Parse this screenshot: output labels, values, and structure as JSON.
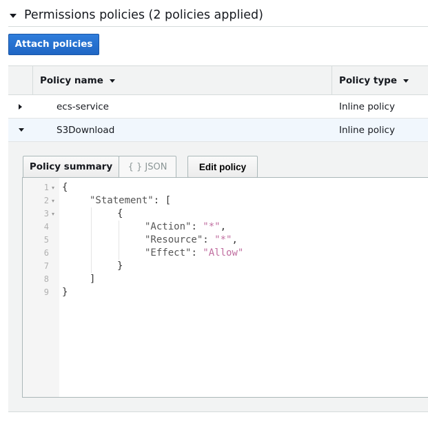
{
  "section": {
    "title": "Permissions policies (2 policies applied)"
  },
  "toolbar": {
    "attach_label": "Attach policies"
  },
  "table": {
    "columns": [
      {
        "label": "Policy name"
      },
      {
        "label": "Policy type"
      }
    ],
    "rows": [
      {
        "name": "ecs-service",
        "type": "Inline policy",
        "expanded": false
      },
      {
        "name": "S3Download",
        "type": "Inline policy",
        "expanded": true
      }
    ]
  },
  "detail": {
    "tabs": [
      {
        "label": "Policy summary"
      },
      {
        "label": "{ } JSON"
      }
    ],
    "edit_label": "Edit policy"
  },
  "editor": {
    "line_numbers": [
      "1",
      "2",
      "3",
      "4",
      "5",
      "6",
      "7",
      "8",
      "9"
    ],
    "lines": [
      {
        "indent": 0,
        "tokens": [
          {
            "t": "punc",
            "v": "{"
          }
        ]
      },
      {
        "indent": 1,
        "tokens": [
          {
            "t": "key",
            "v": "\"Statement\""
          },
          {
            "t": "punc",
            "v": ": ["
          }
        ]
      },
      {
        "indent": 2,
        "tokens": [
          {
            "t": "punc",
            "v": "{"
          }
        ]
      },
      {
        "indent": 3,
        "tokens": [
          {
            "t": "key",
            "v": "\"Action\""
          },
          {
            "t": "punc",
            "v": ": "
          },
          {
            "t": "str",
            "v": "\"*\""
          },
          {
            "t": "punc",
            "v": ","
          }
        ]
      },
      {
        "indent": 3,
        "tokens": [
          {
            "t": "key",
            "v": "\"Resource\""
          },
          {
            "t": "punc",
            "v": ": "
          },
          {
            "t": "str",
            "v": "\"*\""
          },
          {
            "t": "punc",
            "v": ","
          }
        ]
      },
      {
        "indent": 3,
        "tokens": [
          {
            "t": "key",
            "v": "\"Effect\""
          },
          {
            "t": "punc",
            "v": ": "
          },
          {
            "t": "str",
            "v": "\"Allow\""
          }
        ]
      },
      {
        "indent": 2,
        "tokens": [
          {
            "t": "punc",
            "v": "}"
          }
        ]
      },
      {
        "indent": 1,
        "tokens": [
          {
            "t": "punc",
            "v": "]"
          }
        ]
      },
      {
        "indent": 0,
        "tokens": [
          {
            "t": "punc",
            "v": "}"
          }
        ]
      }
    ],
    "fold_lines": [
      1,
      2,
      3
    ]
  },
  "colors": {
    "primary_button": "#1f66c4",
    "string": "#c06ea0",
    "selected_row": "#f1f7fd"
  }
}
